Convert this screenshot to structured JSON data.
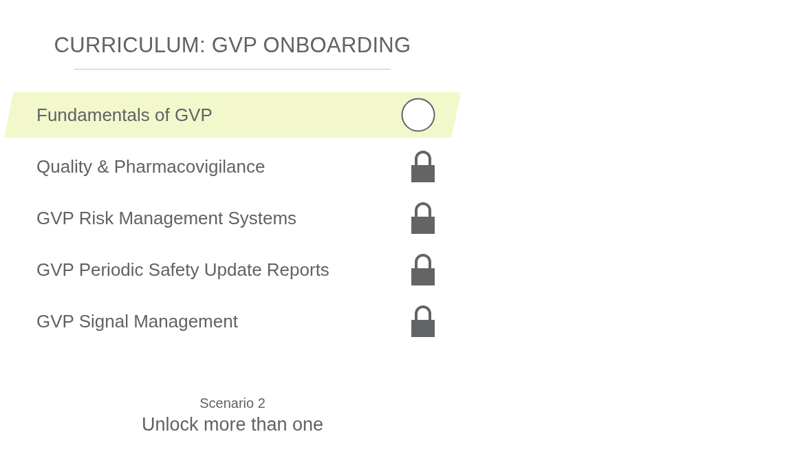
{
  "title": "CURRICULUM: GVP ONBOARDING",
  "courses": [
    {
      "label": "Fundamentals of GVP",
      "selected": true,
      "locked": false
    },
    {
      "label": "Quality & Pharmacovigilance",
      "selected": false,
      "locked": true
    },
    {
      "label": "GVP Risk Management Systems",
      "selected": false,
      "locked": true
    },
    {
      "label": "GVP Periodic Safety Update Reports",
      "selected": false,
      "locked": true
    },
    {
      "label": "GVP Signal Management",
      "selected": false,
      "locked": true
    }
  ],
  "footer": {
    "subtitle": "Scenario 2",
    "caption": "Unlock more than one"
  }
}
